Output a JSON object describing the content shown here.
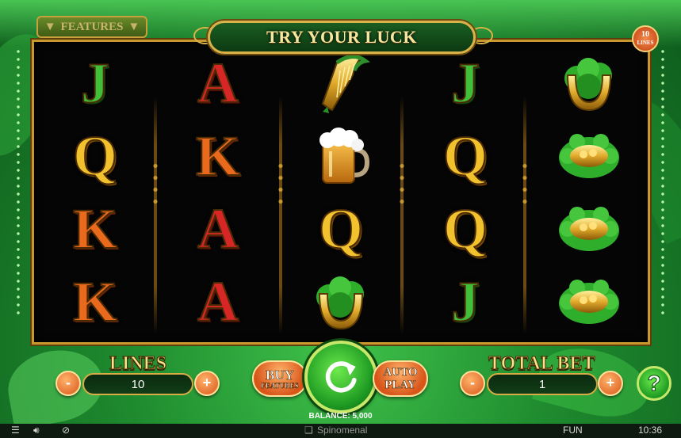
{
  "header": {
    "features_label": "FEATURES",
    "title": "TRY YOUR LUCK",
    "lines_badge_number": "10",
    "lines_badge_text": "LINES"
  },
  "reels": [
    [
      "J",
      "Q",
      "K",
      "K"
    ],
    [
      "A",
      "K",
      "A",
      "A"
    ],
    [
      "harp",
      "beer-mug",
      "Q",
      "horseshoe"
    ],
    [
      "J",
      "Q",
      "Q",
      "J"
    ],
    [
      "horseshoe",
      "pot-of-gold",
      "pot-of-gold",
      "pot-of-gold"
    ]
  ],
  "controls": {
    "lines_label": "LINES",
    "lines_value": "10",
    "minus": "-",
    "plus": "+",
    "buy_label": "BUY",
    "buy_sub": "FEATURES",
    "auto_label": "AUTO",
    "play_label": "PLAY",
    "total_bet_label": "TOTAL BET",
    "total_bet_value": "1",
    "help": "?"
  },
  "balance_text": "BALANCE: 5,000",
  "status_bar": {
    "brand": "Spinomenal",
    "mode": "FUN",
    "time": "10:36"
  },
  "colors": {
    "frame_gold": "#c9982e",
    "button_orange": "#d8561a",
    "spin_green": "#1d9a22"
  }
}
